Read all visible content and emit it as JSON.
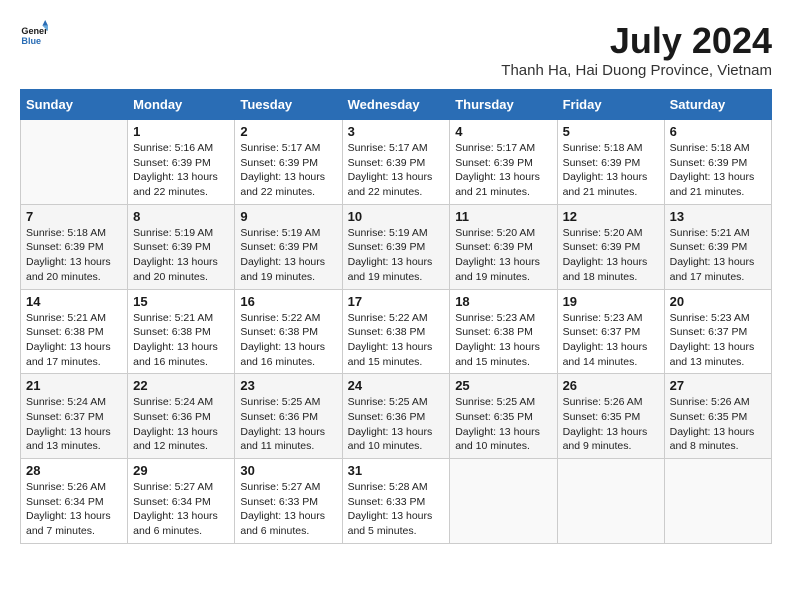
{
  "header": {
    "logo_line1": "General",
    "logo_line2": "Blue",
    "month_year": "July 2024",
    "location": "Thanh Ha, Hai Duong Province, Vietnam"
  },
  "days_of_week": [
    "Sunday",
    "Monday",
    "Tuesday",
    "Wednesday",
    "Thursday",
    "Friday",
    "Saturday"
  ],
  "weeks": [
    [
      {
        "day": "",
        "detail": ""
      },
      {
        "day": "1",
        "detail": "Sunrise: 5:16 AM\nSunset: 6:39 PM\nDaylight: 13 hours\nand 22 minutes."
      },
      {
        "day": "2",
        "detail": "Sunrise: 5:17 AM\nSunset: 6:39 PM\nDaylight: 13 hours\nand 22 minutes."
      },
      {
        "day": "3",
        "detail": "Sunrise: 5:17 AM\nSunset: 6:39 PM\nDaylight: 13 hours\nand 22 minutes."
      },
      {
        "day": "4",
        "detail": "Sunrise: 5:17 AM\nSunset: 6:39 PM\nDaylight: 13 hours\nand 21 minutes."
      },
      {
        "day": "5",
        "detail": "Sunrise: 5:18 AM\nSunset: 6:39 PM\nDaylight: 13 hours\nand 21 minutes."
      },
      {
        "day": "6",
        "detail": "Sunrise: 5:18 AM\nSunset: 6:39 PM\nDaylight: 13 hours\nand 21 minutes."
      }
    ],
    [
      {
        "day": "7",
        "detail": "Sunrise: 5:18 AM\nSunset: 6:39 PM\nDaylight: 13 hours\nand 20 minutes."
      },
      {
        "day": "8",
        "detail": "Sunrise: 5:19 AM\nSunset: 6:39 PM\nDaylight: 13 hours\nand 20 minutes."
      },
      {
        "day": "9",
        "detail": "Sunrise: 5:19 AM\nSunset: 6:39 PM\nDaylight: 13 hours\nand 19 minutes."
      },
      {
        "day": "10",
        "detail": "Sunrise: 5:19 AM\nSunset: 6:39 PM\nDaylight: 13 hours\nand 19 minutes."
      },
      {
        "day": "11",
        "detail": "Sunrise: 5:20 AM\nSunset: 6:39 PM\nDaylight: 13 hours\nand 19 minutes."
      },
      {
        "day": "12",
        "detail": "Sunrise: 5:20 AM\nSunset: 6:39 PM\nDaylight: 13 hours\nand 18 minutes."
      },
      {
        "day": "13",
        "detail": "Sunrise: 5:21 AM\nSunset: 6:39 PM\nDaylight: 13 hours\nand 17 minutes."
      }
    ],
    [
      {
        "day": "14",
        "detail": "Sunrise: 5:21 AM\nSunset: 6:38 PM\nDaylight: 13 hours\nand 17 minutes."
      },
      {
        "day": "15",
        "detail": "Sunrise: 5:21 AM\nSunset: 6:38 PM\nDaylight: 13 hours\nand 16 minutes."
      },
      {
        "day": "16",
        "detail": "Sunrise: 5:22 AM\nSunset: 6:38 PM\nDaylight: 13 hours\nand 16 minutes."
      },
      {
        "day": "17",
        "detail": "Sunrise: 5:22 AM\nSunset: 6:38 PM\nDaylight: 13 hours\nand 15 minutes."
      },
      {
        "day": "18",
        "detail": "Sunrise: 5:23 AM\nSunset: 6:38 PM\nDaylight: 13 hours\nand 15 minutes."
      },
      {
        "day": "19",
        "detail": "Sunrise: 5:23 AM\nSunset: 6:37 PM\nDaylight: 13 hours\nand 14 minutes."
      },
      {
        "day": "20",
        "detail": "Sunrise: 5:23 AM\nSunset: 6:37 PM\nDaylight: 13 hours\nand 13 minutes."
      }
    ],
    [
      {
        "day": "21",
        "detail": "Sunrise: 5:24 AM\nSunset: 6:37 PM\nDaylight: 13 hours\nand 13 minutes."
      },
      {
        "day": "22",
        "detail": "Sunrise: 5:24 AM\nSunset: 6:36 PM\nDaylight: 13 hours\nand 12 minutes."
      },
      {
        "day": "23",
        "detail": "Sunrise: 5:25 AM\nSunset: 6:36 PM\nDaylight: 13 hours\nand 11 minutes."
      },
      {
        "day": "24",
        "detail": "Sunrise: 5:25 AM\nSunset: 6:36 PM\nDaylight: 13 hours\nand 10 minutes."
      },
      {
        "day": "25",
        "detail": "Sunrise: 5:25 AM\nSunset: 6:35 PM\nDaylight: 13 hours\nand 10 minutes."
      },
      {
        "day": "26",
        "detail": "Sunrise: 5:26 AM\nSunset: 6:35 PM\nDaylight: 13 hours\nand 9 minutes."
      },
      {
        "day": "27",
        "detail": "Sunrise: 5:26 AM\nSunset: 6:35 PM\nDaylight: 13 hours\nand 8 minutes."
      }
    ],
    [
      {
        "day": "28",
        "detail": "Sunrise: 5:26 AM\nSunset: 6:34 PM\nDaylight: 13 hours\nand 7 minutes."
      },
      {
        "day": "29",
        "detail": "Sunrise: 5:27 AM\nSunset: 6:34 PM\nDaylight: 13 hours\nand 6 minutes."
      },
      {
        "day": "30",
        "detail": "Sunrise: 5:27 AM\nSunset: 6:33 PM\nDaylight: 13 hours\nand 6 minutes."
      },
      {
        "day": "31",
        "detail": "Sunrise: 5:28 AM\nSunset: 6:33 PM\nDaylight: 13 hours\nand 5 minutes."
      },
      {
        "day": "",
        "detail": ""
      },
      {
        "day": "",
        "detail": ""
      },
      {
        "day": "",
        "detail": ""
      }
    ]
  ]
}
